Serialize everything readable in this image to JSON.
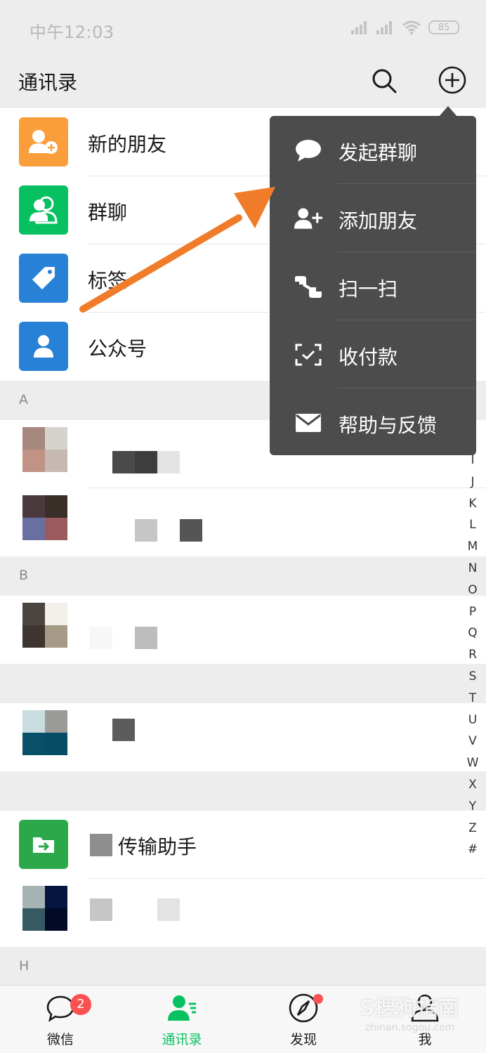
{
  "status_bar": {
    "time": "中午12:03",
    "battery": "85"
  },
  "header": {
    "title": "通讯录"
  },
  "fixed_items": [
    {
      "label": "新的朋友",
      "icon": "add-friend-icon",
      "color": "#fa9d3b"
    },
    {
      "label": "群聊",
      "icon": "group-icon",
      "color": "#07c160"
    },
    {
      "label": "标签",
      "icon": "tag-icon",
      "color": "#2782d7"
    },
    {
      "label": "公众号",
      "icon": "official-account-icon",
      "color": "#2782d7"
    }
  ],
  "sections": [
    {
      "letter": "A"
    },
    {
      "letter": "B"
    },
    {
      "letter": ""
    },
    {
      "letter": "H"
    }
  ],
  "contacts": {
    "file_transfer": "传输助手"
  },
  "index_letters": [
    "I",
    "J",
    "K",
    "L",
    "M",
    "N",
    "O",
    "P",
    "Q",
    "R",
    "S",
    "T",
    "U",
    "V",
    "W",
    "X",
    "Y",
    "Z",
    "#"
  ],
  "popup_menu": [
    {
      "label": "发起群聊",
      "icon": "chat-bubble-icon"
    },
    {
      "label": "添加朋友",
      "icon": "add-friend-icon"
    },
    {
      "label": "扫一扫",
      "icon": "scan-icon"
    },
    {
      "label": "收付款",
      "icon": "payment-icon"
    },
    {
      "label": "帮助与反馈",
      "icon": "mail-icon"
    }
  ],
  "tabbar": [
    {
      "label": "微信",
      "badge": "2"
    },
    {
      "label": "通讯录"
    },
    {
      "label": "发现"
    },
    {
      "label": "我"
    }
  ],
  "watermark": {
    "text": "S搜狗指南",
    "sub": "zhinan.sogou.com"
  },
  "colors": {
    "accent": "#07c160",
    "popup": "#4c4c4c",
    "arrow": "#f07c2a",
    "badge": "#fa5151"
  }
}
